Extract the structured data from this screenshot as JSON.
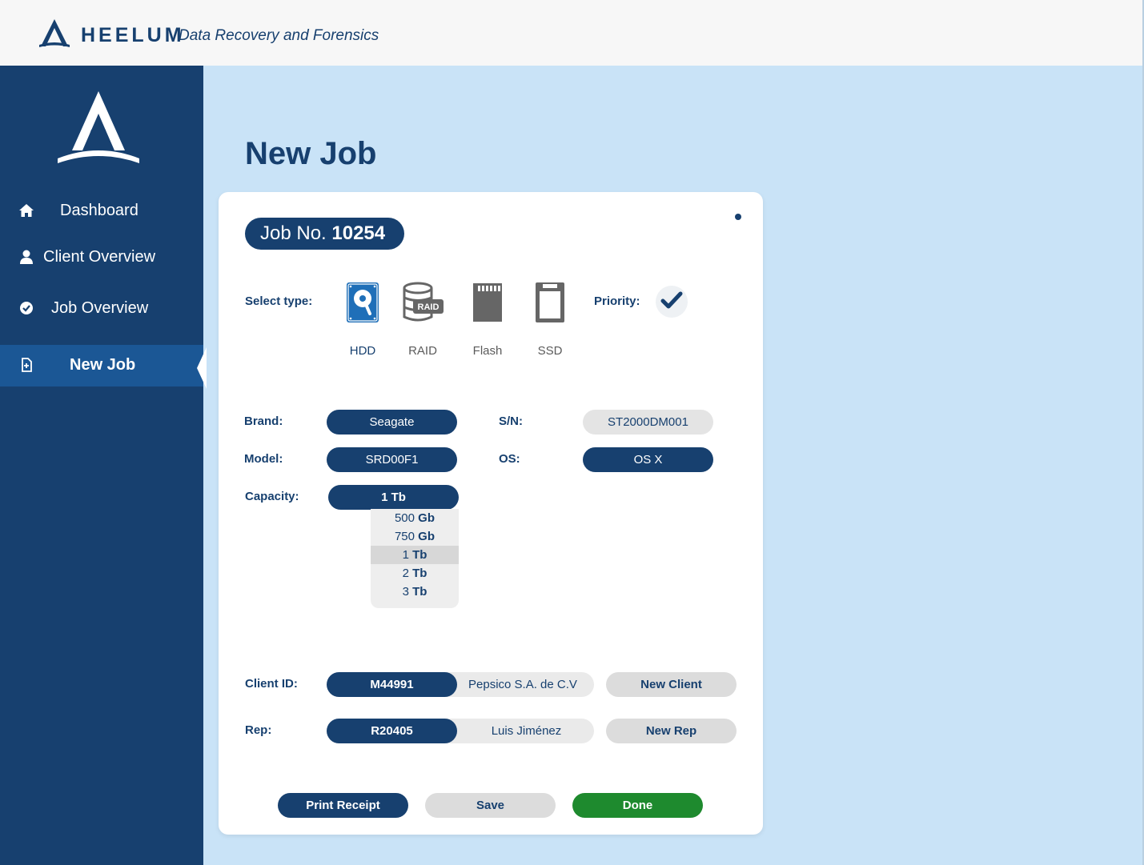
{
  "header": {
    "brand_name": "HEELUM",
    "tagline": "Data Recovery and Forensics"
  },
  "sidebar": {
    "items": [
      {
        "label": "Dashboard",
        "icon": "home-icon",
        "active": false
      },
      {
        "label": "Client Overview",
        "icon": "user-icon",
        "active": false
      },
      {
        "label": "Job Overview",
        "icon": "check-circle-icon",
        "active": false
      },
      {
        "label": "New Job",
        "icon": "new-document-icon",
        "active": true
      }
    ]
  },
  "page": {
    "title": "New Job"
  },
  "job": {
    "prefix": "Job No.",
    "number": "10254"
  },
  "type_select": {
    "label": "Select type:",
    "options": [
      {
        "label": "HDD",
        "icon": "hdd-icon",
        "selected": true
      },
      {
        "label": "RAID",
        "icon": "raid-icon",
        "selected": false
      },
      {
        "label": "Flash",
        "icon": "flash-card-icon",
        "selected": false
      },
      {
        "label": "SSD",
        "icon": "ssd-icon",
        "selected": false
      }
    ]
  },
  "priority": {
    "label": "Priority:",
    "checked": true
  },
  "device": {
    "brand_label": "Brand:",
    "brand_value": "Seagate",
    "sn_label": "S/N:",
    "sn_value": "ST2000DM001",
    "model_label": "Model:",
    "model_value": "SRD00F1",
    "os_label": "OS:",
    "os_value": "OS X",
    "capacity_label": "Capacity:",
    "capacity_value": "1 Tb",
    "capacity_options": [
      {
        "num": "500",
        "unit": "Gb",
        "selected": false
      },
      {
        "num": "750",
        "unit": "Gb",
        "selected": false
      },
      {
        "num": "1",
        "unit": "Tb",
        "selected": true
      },
      {
        "num": "2",
        "unit": "Tb",
        "selected": false
      },
      {
        "num": "3",
        "unit": "Tb",
        "selected": false
      }
    ]
  },
  "client": {
    "label": "Client ID:",
    "id": "M44991",
    "name": "Pepsico S.A. de C.V",
    "new_button": "New Client"
  },
  "rep": {
    "label": "Rep:",
    "id": "R20405",
    "name": "Luis Jiménez",
    "new_button": "New Rep"
  },
  "actions": {
    "print_label": "Print Receipt",
    "save_label": "Save",
    "done_label": "Done"
  },
  "colors": {
    "primary": "#17406f",
    "sidebar_active": "#1b5795",
    "page_bg": "#c9e3f7",
    "done_green": "#1e8a2e",
    "hdd_blue": "#1f6fb8",
    "icon_gray": "#666666"
  }
}
